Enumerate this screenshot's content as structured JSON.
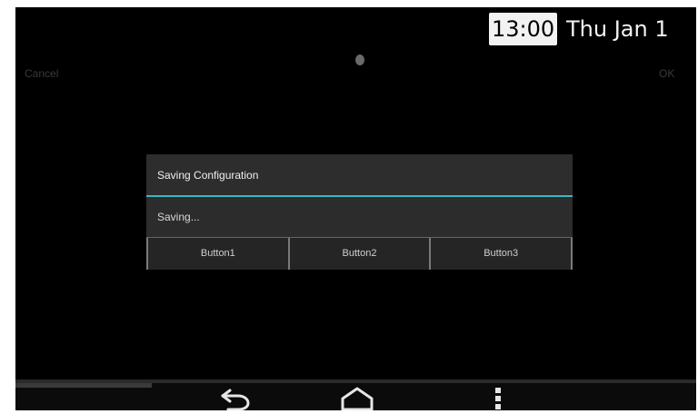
{
  "status_bar": {
    "time": "13:00",
    "date": "Thu Jan 1"
  },
  "action_bar": {
    "left_label": "Cancel",
    "right_label": "OK"
  },
  "dialog": {
    "title": "Saving Configuration",
    "message": "Saving...",
    "buttons": [
      {
        "label": "Button1"
      },
      {
        "label": "Button2"
      },
      {
        "label": "Button3"
      }
    ]
  },
  "navigation": {
    "back_icon": "back-arrow-icon",
    "home_icon": "home-icon",
    "menu_icon": "overflow-menu-icon"
  },
  "colors": {
    "background": "#000000",
    "accent": "#3ab8c8",
    "text_primary": "#f0f0f0",
    "text_muted": "#3a3a3a"
  }
}
